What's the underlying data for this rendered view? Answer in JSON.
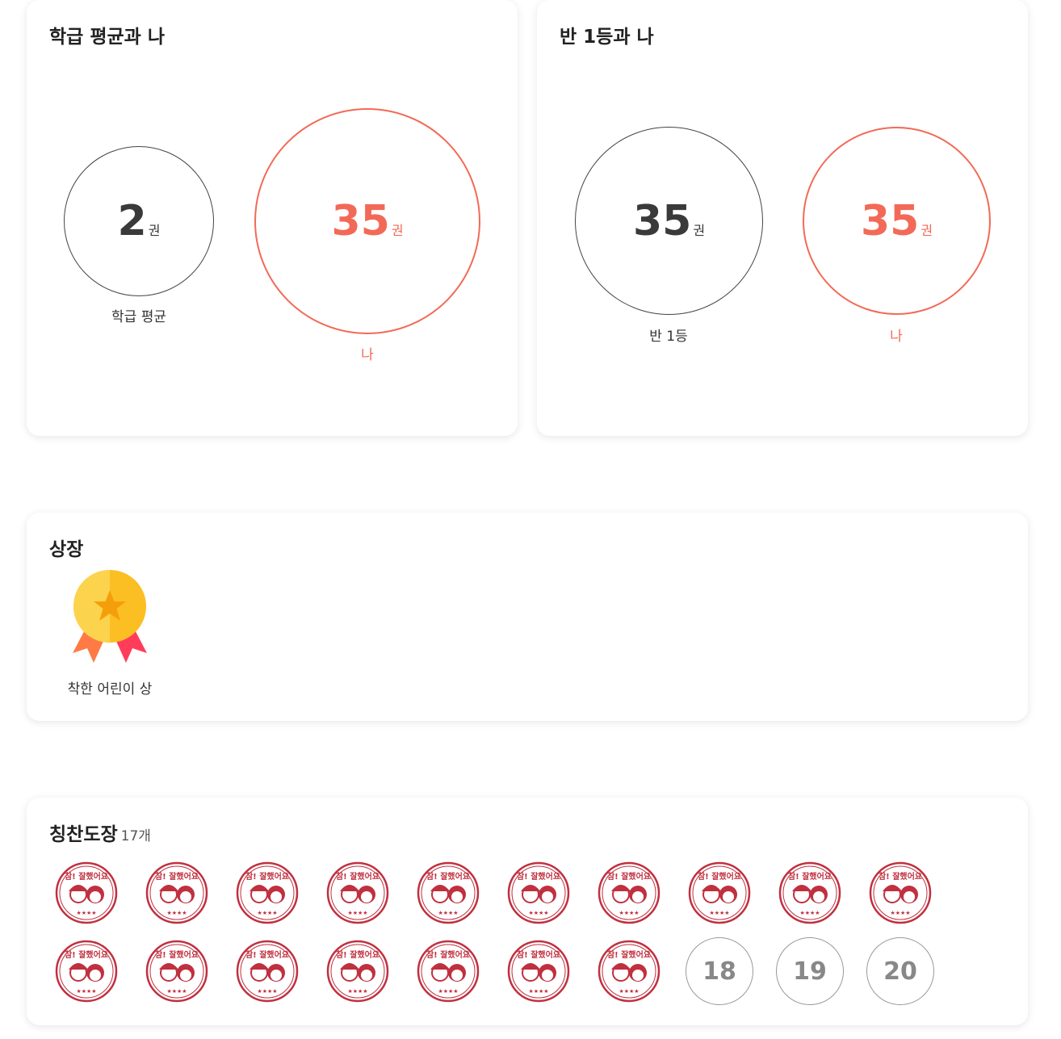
{
  "class_avg_card": {
    "title": "학급 평균과 나",
    "avg": {
      "value": "2",
      "unit": "권",
      "label": "학급 평균"
    },
    "me": {
      "value": "35",
      "unit": "권",
      "label": "나"
    }
  },
  "top_card": {
    "title": "반 1등과 나",
    "top": {
      "value": "35",
      "unit": "권",
      "label": "반 1등"
    },
    "me": {
      "value": "35",
      "unit": "권",
      "label": "나"
    }
  },
  "awards_card": {
    "title": "상장",
    "awards": [
      {
        "label": "착한 어린이 상",
        "icon": "medal-icon"
      }
    ]
  },
  "stamps_card": {
    "title": "칭찬도장",
    "count": "17개",
    "stamp_text": "참! 잘했어요",
    "filled": 17,
    "empty_slots": [
      "18",
      "19",
      "20"
    ],
    "accent": "#c0303f"
  },
  "colors": {
    "me": "#f26a57",
    "neutral": "#444444"
  }
}
